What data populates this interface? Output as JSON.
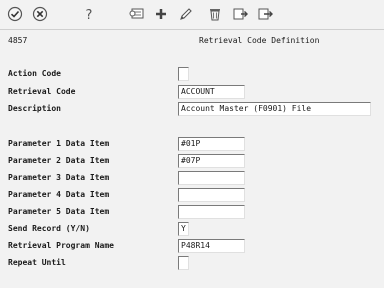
{
  "toolbar": {
    "icons": [
      "ok-check-icon",
      "cancel-x-icon",
      "help-question-icon",
      "display-icon",
      "add-plus-icon",
      "edit-pencil-icon",
      "delete-trash-icon",
      "copy-icon",
      "export-icon"
    ]
  },
  "header": {
    "code": "4857",
    "title": "Retrieval Code Definition"
  },
  "form": {
    "action_code": {
      "label": "Action Code",
      "value": ""
    },
    "retrieval_code": {
      "label": "Retrieval Code",
      "value": "ACCOUNT"
    },
    "description": {
      "label": "Description",
      "value": "Account Master (F0901) File"
    },
    "param1": {
      "label": "Parameter 1 Data Item",
      "value": "#01P"
    },
    "param2": {
      "label": "Parameter 2 Data Item",
      "value": "#07P"
    },
    "param3": {
      "label": "Parameter 3 Data Item",
      "value": ""
    },
    "param4": {
      "label": "Parameter 4 Data Item",
      "value": ""
    },
    "param5": {
      "label": "Parameter 5 Data Item",
      "value": ""
    },
    "send_record": {
      "label": "Send Record (Y/N)",
      "value": "Y"
    },
    "program_name": {
      "label": "Retrieval Program Name",
      "value": "P48R14"
    },
    "repeat_until": {
      "label": "Repeat Until",
      "value": ""
    }
  }
}
